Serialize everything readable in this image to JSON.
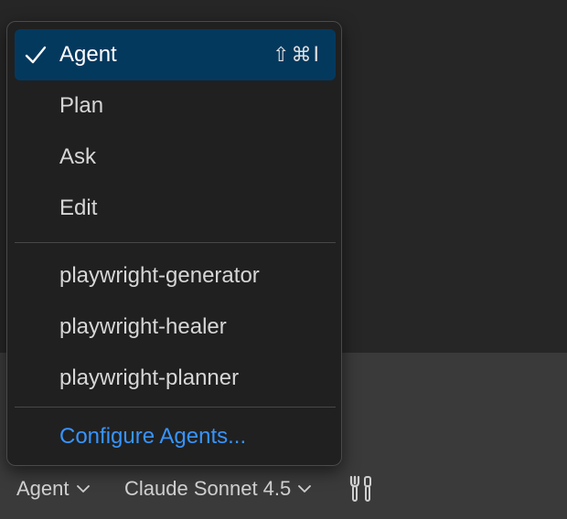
{
  "menu": {
    "items": [
      {
        "label": "Agent",
        "shortcut": "⇧⌘I",
        "selected": true
      },
      {
        "label": "Plan"
      },
      {
        "label": "Ask"
      },
      {
        "label": "Edit"
      }
    ],
    "custom_agents": [
      {
        "label": "playwright-generator"
      },
      {
        "label": "playwright-healer"
      },
      {
        "label": "playwright-planner"
      }
    ],
    "configure_label": "Configure Agents..."
  },
  "toolbar": {
    "mode_label": "Agent",
    "model_label": "Claude Sonnet 4.5",
    "tools_icon": "tools-icon"
  },
  "colors": {
    "selected_bg": "#04395e",
    "link": "#3794ff",
    "menu_bg": "#202020"
  }
}
